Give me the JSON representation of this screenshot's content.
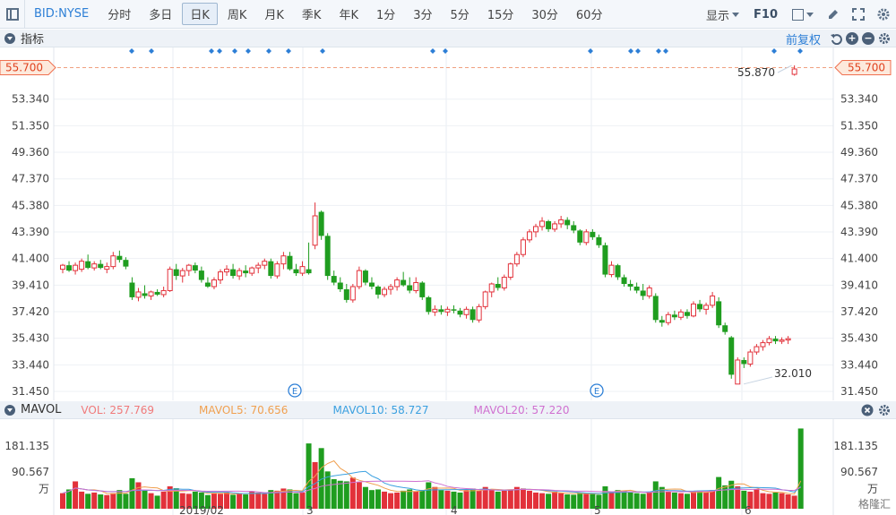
{
  "toolbar": {
    "symbol": "BID:NYSE",
    "periods": [
      "分时",
      "多日",
      "日K",
      "周K",
      "月K",
      "季K",
      "年K",
      "1分",
      "3分",
      "5分",
      "15分",
      "30分",
      "60分"
    ],
    "active_period": "日K",
    "display_label": "显示",
    "f10_label": "F10"
  },
  "indicator_panel": {
    "title": "指标",
    "adjust_label": "前复权",
    "icons": [
      "undo-icon",
      "zoom-in-icon",
      "zoom-out-icon",
      "settings-icon"
    ]
  },
  "price_axis": {
    "labels": [
      "53.340",
      "51.350",
      "49.360",
      "47.370",
      "45.380",
      "43.390",
      "41.400",
      "39.410",
      "37.420",
      "35.430",
      "33.440",
      "31.450"
    ],
    "current_price": "55.700",
    "high_annotation": "55.870",
    "low_annotation": "32.010"
  },
  "x_axis": {
    "labels": [
      "2019/02",
      "3",
      "4",
      "5",
      "6"
    ]
  },
  "earnings_markers": [
    "E",
    "E"
  ],
  "volume_panel": {
    "title": "MAVOL",
    "legend": [
      {
        "label": "VOL: 257.769",
        "color": "#f07a7a"
      },
      {
        "label": "MAVOL5: 70.656",
        "color": "#f0a050"
      },
      {
        "label": "MAVOL10: 58.727",
        "color": "#3aa0e0"
      },
      {
        "label": "MAVOL20: 57.220",
        "color": "#d070d0"
      }
    ],
    "axis_labels": [
      "181.135",
      "90.567",
      "万"
    ]
  },
  "watermark": "格隆汇",
  "colors": {
    "up": "#e2313a",
    "down": "#1f9d1f",
    "accent": "#2d7fd6",
    "current_price": "#f07050"
  },
  "chart_data": {
    "type": "candlestick",
    "ylim": [
      31.45,
      55.87
    ],
    "candles": [
      {
        "o": 40.6,
        "h": 41.0,
        "l": 40.3,
        "c": 40.9
      },
      {
        "o": 40.9,
        "h": 41.2,
        "l": 40.4,
        "c": 40.5
      },
      {
        "o": 40.5,
        "h": 41.1,
        "l": 40.2,
        "c": 40.9
      },
      {
        "o": 40.6,
        "h": 41.4,
        "l": 40.4,
        "c": 41.2
      },
      {
        "o": 41.2,
        "h": 41.7,
        "l": 40.6,
        "c": 40.7
      },
      {
        "o": 40.7,
        "h": 41.2,
        "l": 40.5,
        "c": 41.0
      },
      {
        "o": 41.0,
        "h": 41.3,
        "l": 40.6,
        "c": 40.7
      },
      {
        "o": 40.6,
        "h": 41.1,
        "l": 40.3,
        "c": 40.8
      },
      {
        "o": 40.8,
        "h": 41.9,
        "l": 40.6,
        "c": 41.6
      },
      {
        "o": 41.6,
        "h": 42.0,
        "l": 41.1,
        "c": 41.3
      },
      {
        "o": 41.3,
        "h": 41.5,
        "l": 40.6,
        "c": 40.8
      },
      {
        "o": 39.6,
        "h": 40.0,
        "l": 38.3,
        "c": 38.5
      },
      {
        "o": 38.5,
        "h": 39.2,
        "l": 38.2,
        "c": 38.9
      },
      {
        "o": 38.8,
        "h": 39.4,
        "l": 38.4,
        "c": 38.6
      },
      {
        "o": 38.6,
        "h": 39.0,
        "l": 38.3,
        "c": 38.9
      },
      {
        "o": 38.9,
        "h": 39.1,
        "l": 38.6,
        "c": 38.7
      },
      {
        "o": 38.7,
        "h": 39.3,
        "l": 38.5,
        "c": 39.0
      },
      {
        "o": 39.0,
        "h": 40.8,
        "l": 38.9,
        "c": 40.6
      },
      {
        "o": 40.6,
        "h": 41.0,
        "l": 39.8,
        "c": 40.1
      },
      {
        "o": 40.1,
        "h": 40.7,
        "l": 39.6,
        "c": 40.5
      },
      {
        "o": 40.5,
        "h": 41.0,
        "l": 40.1,
        "c": 40.9
      },
      {
        "o": 40.9,
        "h": 41.1,
        "l": 40.3,
        "c": 40.5
      },
      {
        "o": 40.5,
        "h": 40.8,
        "l": 39.6,
        "c": 39.8
      },
      {
        "o": 39.6,
        "h": 40.0,
        "l": 39.2,
        "c": 39.3
      },
      {
        "o": 39.3,
        "h": 40.0,
        "l": 39.1,
        "c": 39.8
      },
      {
        "o": 39.8,
        "h": 40.6,
        "l": 39.5,
        "c": 40.4
      },
      {
        "o": 40.4,
        "h": 40.9,
        "l": 40.1,
        "c": 40.6
      },
      {
        "o": 40.6,
        "h": 41.0,
        "l": 39.9,
        "c": 40.1
      },
      {
        "o": 40.1,
        "h": 40.7,
        "l": 39.8,
        "c": 40.5
      },
      {
        "o": 40.5,
        "h": 40.9,
        "l": 40.0,
        "c": 40.3
      },
      {
        "o": 40.3,
        "h": 40.8,
        "l": 40.1,
        "c": 40.7
      },
      {
        "o": 40.7,
        "h": 41.1,
        "l": 40.3,
        "c": 40.9
      },
      {
        "o": 40.9,
        "h": 41.4,
        "l": 40.6,
        "c": 41.2
      },
      {
        "o": 41.2,
        "h": 41.4,
        "l": 39.9,
        "c": 40.1
      },
      {
        "o": 40.1,
        "h": 41.2,
        "l": 39.9,
        "c": 41.0
      },
      {
        "o": 41.0,
        "h": 41.9,
        "l": 40.6,
        "c": 41.6
      },
      {
        "o": 41.6,
        "h": 41.9,
        "l": 40.5,
        "c": 40.6
      },
      {
        "o": 40.6,
        "h": 41.0,
        "l": 40.1,
        "c": 40.3
      },
      {
        "o": 40.3,
        "h": 41.2,
        "l": 40.1,
        "c": 40.8
      },
      {
        "o": 40.6,
        "h": 42.6,
        "l": 40.2,
        "c": 40.3
      },
      {
        "o": 42.4,
        "h": 45.6,
        "l": 42.1,
        "c": 44.6
      },
      {
        "o": 44.9,
        "h": 45.0,
        "l": 42.8,
        "c": 43.1
      },
      {
        "o": 43.1,
        "h": 43.3,
        "l": 39.8,
        "c": 40.1
      },
      {
        "o": 40.1,
        "h": 40.5,
        "l": 39.4,
        "c": 39.6
      },
      {
        "o": 39.6,
        "h": 40.0,
        "l": 38.9,
        "c": 39.1
      },
      {
        "o": 39.1,
        "h": 39.5,
        "l": 38.1,
        "c": 38.3
      },
      {
        "o": 38.3,
        "h": 39.5,
        "l": 38.1,
        "c": 39.3
      },
      {
        "o": 39.3,
        "h": 40.8,
        "l": 39.1,
        "c": 40.5
      },
      {
        "o": 40.5,
        "h": 40.6,
        "l": 39.4,
        "c": 39.6
      },
      {
        "o": 39.6,
        "h": 40.0,
        "l": 39.1,
        "c": 39.3
      },
      {
        "o": 39.3,
        "h": 39.4,
        "l": 38.4,
        "c": 38.7
      },
      {
        "o": 38.7,
        "h": 39.3,
        "l": 38.5,
        "c": 39.1
      },
      {
        "o": 39.1,
        "h": 39.5,
        "l": 38.7,
        "c": 39.3
      },
      {
        "o": 39.3,
        "h": 40.0,
        "l": 39.0,
        "c": 39.8
      },
      {
        "o": 39.8,
        "h": 40.4,
        "l": 39.3,
        "c": 39.4
      },
      {
        "o": 39.4,
        "h": 40.0,
        "l": 38.8,
        "c": 39.0
      },
      {
        "o": 39.0,
        "h": 40.0,
        "l": 38.8,
        "c": 39.6
      },
      {
        "o": 39.6,
        "h": 39.7,
        "l": 38.3,
        "c": 38.5
      },
      {
        "o": 38.5,
        "h": 38.6,
        "l": 37.2,
        "c": 37.4
      },
      {
        "o": 37.4,
        "h": 37.9,
        "l": 37.1,
        "c": 37.6
      },
      {
        "o": 37.6,
        "h": 37.9,
        "l": 37.2,
        "c": 37.4
      },
      {
        "o": 37.4,
        "h": 37.8,
        "l": 37.1,
        "c": 37.6
      },
      {
        "o": 37.6,
        "h": 37.9,
        "l": 37.3,
        "c": 37.5
      },
      {
        "o": 37.5,
        "h": 37.7,
        "l": 37.0,
        "c": 37.2
      },
      {
        "o": 37.2,
        "h": 37.8,
        "l": 36.9,
        "c": 37.6
      },
      {
        "o": 37.6,
        "h": 37.8,
        "l": 36.6,
        "c": 36.8
      },
      {
        "o": 36.8,
        "h": 38.0,
        "l": 36.6,
        "c": 37.8
      },
      {
        "o": 37.8,
        "h": 39.0,
        "l": 37.6,
        "c": 38.9
      },
      {
        "o": 38.9,
        "h": 39.6,
        "l": 38.5,
        "c": 39.5
      },
      {
        "o": 39.5,
        "h": 40.0,
        "l": 39.0,
        "c": 39.2
      },
      {
        "o": 39.2,
        "h": 40.2,
        "l": 39.0,
        "c": 40.0
      },
      {
        "o": 40.0,
        "h": 41.1,
        "l": 39.8,
        "c": 41.0
      },
      {
        "o": 41.0,
        "h": 41.9,
        "l": 40.8,
        "c": 41.7
      },
      {
        "o": 41.7,
        "h": 43.0,
        "l": 41.5,
        "c": 42.8
      },
      {
        "o": 42.8,
        "h": 43.6,
        "l": 42.6,
        "c": 43.4
      },
      {
        "o": 43.4,
        "h": 44.0,
        "l": 43.0,
        "c": 43.8
      },
      {
        "o": 43.8,
        "h": 44.5,
        "l": 43.5,
        "c": 44.2
      },
      {
        "o": 44.2,
        "h": 44.3,
        "l": 43.4,
        "c": 43.6
      },
      {
        "o": 43.6,
        "h": 44.2,
        "l": 43.4,
        "c": 44.0
      },
      {
        "o": 44.0,
        "h": 44.6,
        "l": 43.7,
        "c": 44.3
      },
      {
        "o": 44.3,
        "h": 44.5,
        "l": 43.6,
        "c": 43.9
      },
      {
        "o": 43.9,
        "h": 44.2,
        "l": 43.3,
        "c": 43.5
      },
      {
        "o": 43.5,
        "h": 43.6,
        "l": 42.4,
        "c": 42.6
      },
      {
        "o": 42.6,
        "h": 43.6,
        "l": 42.4,
        "c": 43.4
      },
      {
        "o": 43.4,
        "h": 43.6,
        "l": 42.8,
        "c": 43.0
      },
      {
        "o": 43.0,
        "h": 43.2,
        "l": 42.2,
        "c": 42.4
      },
      {
        "o": 42.4,
        "h": 42.6,
        "l": 40.0,
        "c": 40.2
      },
      {
        "o": 40.2,
        "h": 41.2,
        "l": 40.0,
        "c": 40.9
      },
      {
        "o": 40.9,
        "h": 41.0,
        "l": 39.8,
        "c": 40.0
      },
      {
        "o": 40.0,
        "h": 40.2,
        "l": 39.3,
        "c": 39.5
      },
      {
        "o": 39.5,
        "h": 39.8,
        "l": 39.0,
        "c": 39.3
      },
      {
        "o": 39.3,
        "h": 39.6,
        "l": 38.8,
        "c": 39.0
      },
      {
        "o": 39.0,
        "h": 39.5,
        "l": 38.3,
        "c": 38.6
      },
      {
        "o": 38.6,
        "h": 39.4,
        "l": 38.4,
        "c": 39.2
      },
      {
        "o": 38.6,
        "h": 38.8,
        "l": 36.6,
        "c": 36.8
      },
      {
        "o": 36.8,
        "h": 37.1,
        "l": 36.3,
        "c": 36.6
      },
      {
        "o": 36.6,
        "h": 37.4,
        "l": 36.4,
        "c": 37.2
      },
      {
        "o": 37.2,
        "h": 37.5,
        "l": 36.8,
        "c": 37.0
      },
      {
        "o": 37.0,
        "h": 37.6,
        "l": 36.8,
        "c": 37.4
      },
      {
        "o": 37.4,
        "h": 37.6,
        "l": 36.9,
        "c": 37.1
      },
      {
        "o": 37.1,
        "h": 38.2,
        "l": 37.0,
        "c": 38.0
      },
      {
        "o": 38.0,
        "h": 38.3,
        "l": 37.4,
        "c": 37.6
      },
      {
        "o": 37.6,
        "h": 38.1,
        "l": 37.2,
        "c": 37.9
      },
      {
        "o": 37.9,
        "h": 38.9,
        "l": 37.7,
        "c": 38.6
      },
      {
        "o": 38.2,
        "h": 38.5,
        "l": 36.2,
        "c": 36.4
      },
      {
        "o": 36.4,
        "h": 36.6,
        "l": 35.7,
        "c": 35.9
      },
      {
        "o": 35.5,
        "h": 35.6,
        "l": 32.4,
        "c": 32.7
      },
      {
        "o": 32.0,
        "h": 34.0,
        "l": 32.0,
        "c": 33.8
      },
      {
        "o": 33.8,
        "h": 34.0,
        "l": 33.2,
        "c": 33.5
      },
      {
        "o": 33.5,
        "h": 34.6,
        "l": 33.3,
        "c": 34.4
      },
      {
        "o": 34.4,
        "h": 35.0,
        "l": 34.2,
        "c": 34.8
      },
      {
        "o": 34.8,
        "h": 35.3,
        "l": 34.5,
        "c": 35.1
      },
      {
        "o": 35.1,
        "h": 35.6,
        "l": 34.9,
        "c": 35.4
      },
      {
        "o": 35.4,
        "h": 35.6,
        "l": 35.0,
        "c": 35.2
      },
      {
        "o": 35.2,
        "h": 35.5,
        "l": 35.0,
        "c": 35.3
      },
      {
        "o": 35.3,
        "h": 35.6,
        "l": 35.0,
        "c": 35.4
      },
      {
        "o": 55.2,
        "h": 55.87,
        "l": 55.1,
        "c": 55.6
      }
    ],
    "volume": [
      50,
      62,
      88,
      55,
      48,
      52,
      46,
      44,
      50,
      60,
      48,
      98,
      85,
      60,
      50,
      42,
      55,
      72,
      66,
      50,
      48,
      55,
      52,
      44,
      50,
      48,
      52,
      45,
      50,
      46,
      55,
      52,
      48,
      60,
      58,
      65,
      62,
      50,
      52,
      210,
      150,
      195,
      120,
      95,
      90,
      88,
      100,
      85,
      70,
      60,
      62,
      55,
      50,
      52,
      58,
      62,
      56,
      60,
      85,
      70,
      60,
      58,
      55,
      52,
      60,
      65,
      58,
      70,
      62,
      55,
      58,
      62,
      70,
      65,
      58,
      52,
      50,
      48,
      55,
      50,
      46,
      45,
      52,
      48,
      50,
      45,
      72,
      55,
      60,
      58,
      52,
      50,
      48,
      52,
      88,
      70,
      55,
      52,
      50,
      48,
      55,
      58,
      52,
      60,
      102,
      75,
      90,
      72,
      58,
      55,
      62,
      50,
      48,
      52,
      50,
      46,
      42,
      258
    ]
  }
}
